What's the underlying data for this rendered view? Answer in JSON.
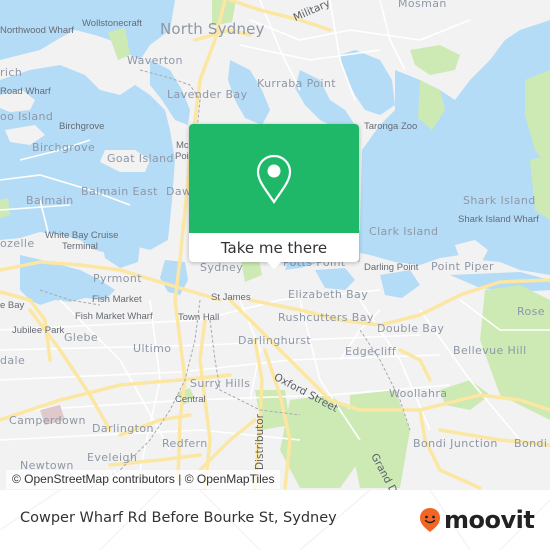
{
  "map": {
    "labels": {
      "north_sydney": "North Sydney",
      "military_rd": "Military",
      "mosman": "Mosman",
      "wollstonecraft": "Wollstonecraft",
      "northwood_wharf": "Northwood Wharf",
      "waverton": "Waverton",
      "lavender_bay": "Lavender Bay",
      "kurraba_point": "Kurraba Point",
      "taronga_zoo": "Taronga Zoo",
      "greenwich": "rich",
      "road_wharf": "Road Wharf",
      "cockatoo_island": "oo Island",
      "birchgrove_wharf": "Birchgrove",
      "birchgrove": "Birchgrove",
      "goat_island": "Goat Island",
      "mcmahons_point": "Mc",
      "mcmahons_point2": "Poi",
      "balmain_east": "Balmain East",
      "dawes": "Daw",
      "balmain": "Balmain",
      "shark_island": "Shark Island",
      "shark_island_wharf": "Shark Island Wharf",
      "rozelle": "ozelle",
      "white_bay": "White Bay Cruise",
      "white_bay2": "Terminal",
      "clark_island": "Clark Island",
      "sydney": "Sydney",
      "potts_point": "Potts Point",
      "darling_point": "Darling Point",
      "point_piper": "Point Piper",
      "pyrmont": "Pyrmont",
      "st_james": "St James",
      "elizabeth_bay": "Elizabeth Bay",
      "fish_market": "Fish Market",
      "rose_bay": "Rose B",
      "bay_left": "e Bay",
      "fish_market_wharf": "Fish Market Wharf",
      "town_hall": "Town Hall",
      "rushcutters_bay": "Rushcutters Bay",
      "double_bay": "Double Bay",
      "jubilee_park": "Jubilee Park",
      "glebe": "Glebe",
      "ultimo": "Ultimo",
      "darlinghurst": "Darlinghurst",
      "edgecliff": "Edgecliff",
      "bellevue_hill": "Bellevue Hill",
      "leichhardt": "dale",
      "surry_hills": "Surry Hills",
      "oxford_street": "Oxford Street",
      "woollahra": "Woollahra",
      "central": "Central",
      "camperdown": "Camperdown",
      "darlington": "Darlington",
      "redfern": "Redfern",
      "distributor": "Distributor",
      "grand_drive": "Grand D",
      "bondi_junction": "Bondi Junction",
      "bondi": "Bondi",
      "eveleigh": "Eveleigh",
      "newtown": "Newtown"
    },
    "popup": {
      "icon": "map-pin-icon",
      "cta_label": "Take me there"
    },
    "attribution": "© OpenStreetMap contributors | © OpenMapTiles"
  },
  "footer": {
    "stop_title": "Cowper Wharf Rd Before Bourke St, Sydney",
    "brand_name": "moovit",
    "brand_icon": "moovit-smiley-pin-icon"
  },
  "colors": {
    "water": "#b4dcf7",
    "land": "#f2f2f2",
    "park": "#cdeab5",
    "road_major": "#fbe6a2",
    "accent_green": "#1fb869",
    "brand_orange": "#f26522"
  }
}
